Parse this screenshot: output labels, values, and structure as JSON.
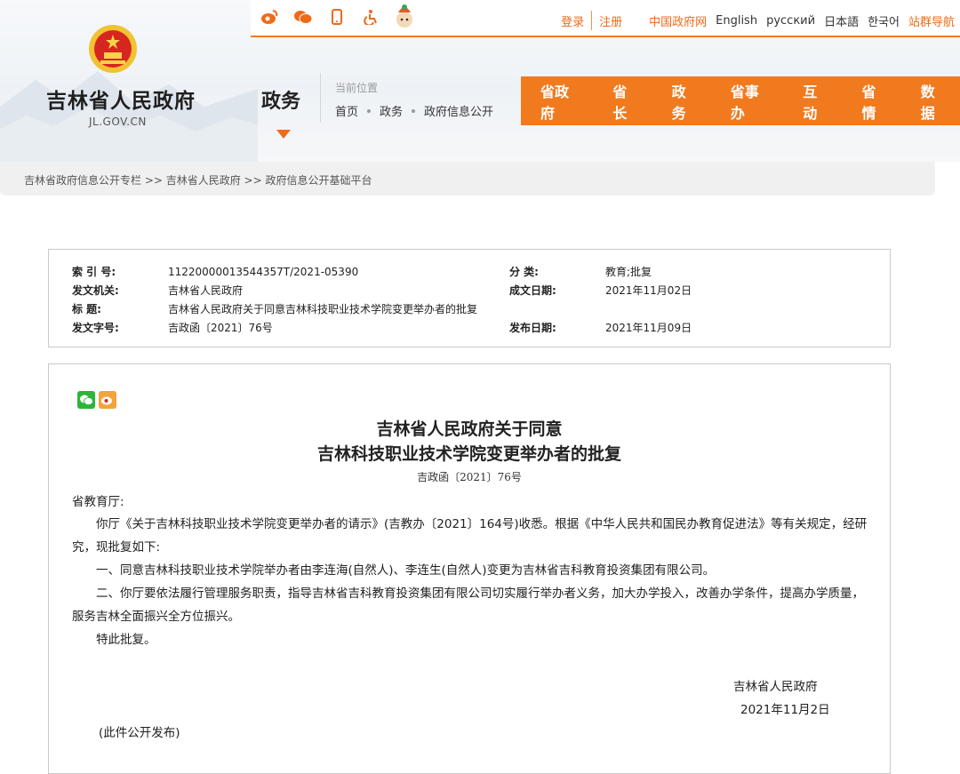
{
  "header": {
    "site_name": "吉林省人民政府",
    "site_domain": "JL.GOV.CN",
    "top_icons": [
      "weibo-icon",
      "wechat-icon",
      "mobile-icon",
      "accessibility-icon",
      "mascot-icon"
    ],
    "login": "登录",
    "register": "注册",
    "languages": [
      "中国政府网",
      "English",
      "русский",
      "日本語",
      "한국어",
      "站群导航"
    ],
    "section_title": "政务",
    "location_label": "当前位置",
    "location_path": [
      "首页",
      "政务",
      "政府信息公开"
    ],
    "nav_items": [
      "省政府",
      "省长",
      "政务",
      "省事办",
      "互动",
      "省情",
      "数据"
    ],
    "accent_color": "#f17a1f"
  },
  "breadcrumb": "吉林省政府信息公开专栏 >> 吉林省人民政府 >> 政府信息公开基础平台",
  "info": {
    "index_label": "索 引 号:",
    "index_value": "11220000013544357T/2021-05390",
    "category_label": "分    类:",
    "category_value": "教育;批复",
    "issuer_label": "发文机关:",
    "issuer_value": "吉林省人民政府",
    "written_date_label": "成文日期:",
    "written_date_value": "2021年11月02日",
    "title_label": "标      题:",
    "title_value": "吉林省人民政府关于同意吉林科技职业技术学院变更举办者的批复",
    "doc_no_label": "发文字号:",
    "doc_no_value": "吉政函〔2021〕76号",
    "publish_date_label": "发布日期:",
    "publish_date_value": "2021年11月09日"
  },
  "document": {
    "title_line1": "吉林省人民政府关于同意",
    "title_line2": "吉林科技职业技术学院变更举办者的批复",
    "doc_number": "吉政函〔2021〕76号",
    "salutation": "省教育厅:",
    "para1": "你厅《关于吉林科技职业技术学院变更举办者的请示》(吉教办〔2021〕164号)收悉。根据《中华人民共和国民办教育促进法》等有关规定，经研究，现批复如下:",
    "para2": "一、同意吉林科技职业技术学院举办者由李连海(自然人)、李连生(自然人)变更为吉林省吉科教育投资集团有限公司。",
    "para3": "二、你厅要依法履行管理服务职责，指导吉林省吉科教育投资集团有限公司切实履行举办者义务，加大办学投入，改善办学条件，提高办学质量，服务吉林全面振兴全方位振兴。",
    "para4": "特此批复。",
    "signature": "吉林省人民政府",
    "sign_date": "2021年11月2日",
    "note": "(此件公开发布)"
  }
}
